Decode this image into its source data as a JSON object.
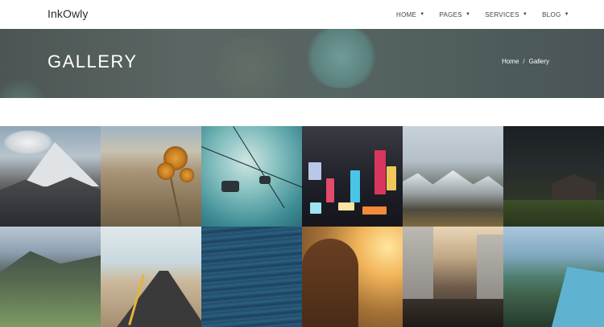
{
  "brand": {
    "logo": "InkOwly"
  },
  "nav": {
    "items": [
      {
        "label": "HOME",
        "caret": "▼"
      },
      {
        "label": "PAGES",
        "caret": "▼"
      },
      {
        "label": "SERVICES",
        "caret": "▼"
      },
      {
        "label": "BLOG",
        "caret": "▼"
      }
    ]
  },
  "hero": {
    "title": "GALLERY",
    "breadcrumb": {
      "home": "Home",
      "separator": "/",
      "current": "Gallery"
    }
  },
  "gallery": {
    "images": [
      {
        "subject": "snowy mountain peak"
      },
      {
        "subject": "desert flower"
      },
      {
        "subject": "cable cars"
      },
      {
        "subject": "city lights at night"
      },
      {
        "subject": "snowy mountain range"
      },
      {
        "subject": "cabin at night"
      },
      {
        "subject": "green cliffs"
      },
      {
        "subject": "desert road"
      },
      {
        "subject": "ocean waves"
      },
      {
        "subject": "woman in sunset field"
      },
      {
        "subject": "busy city street"
      },
      {
        "subject": "fjord landscape"
      }
    ]
  }
}
